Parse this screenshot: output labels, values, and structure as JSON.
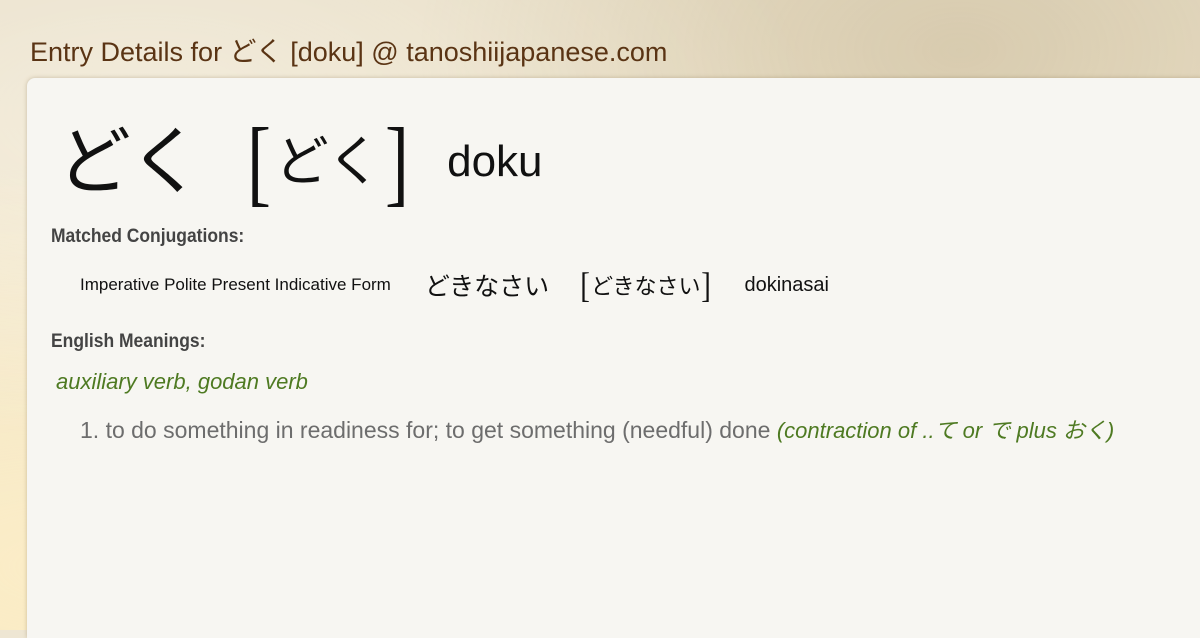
{
  "page": {
    "title": "Entry Details for どく [doku] @ tanoshiijapanese.com"
  },
  "entry": {
    "kanji": "どく",
    "bracket_open": "[",
    "reading": "どく",
    "bracket_close": "]",
    "romaji": "doku"
  },
  "conjugations": {
    "label": "Matched Conjugations:",
    "items": [
      {
        "form": "Imperative Polite Present Indicative Form",
        "kana": "どきなさい",
        "bracket_open": "[",
        "reading": "どきなさい",
        "bracket_close": "]",
        "romaji": "dokinasai"
      }
    ]
  },
  "meanings": {
    "label": "English Meanings:",
    "pos": "auxiliary verb, godan verb",
    "items": [
      {
        "text": "1. to do something in readiness for; to get something (needful) done ",
        "note": "(contraction of ..て or で plus おく)"
      }
    ]
  },
  "colors": {
    "title": "#5a3414",
    "label": "#444444",
    "pos": "#4e7a22",
    "meaning": "#6d6d6d",
    "card": "#f7f6f2",
    "background": "#efe4c8"
  }
}
